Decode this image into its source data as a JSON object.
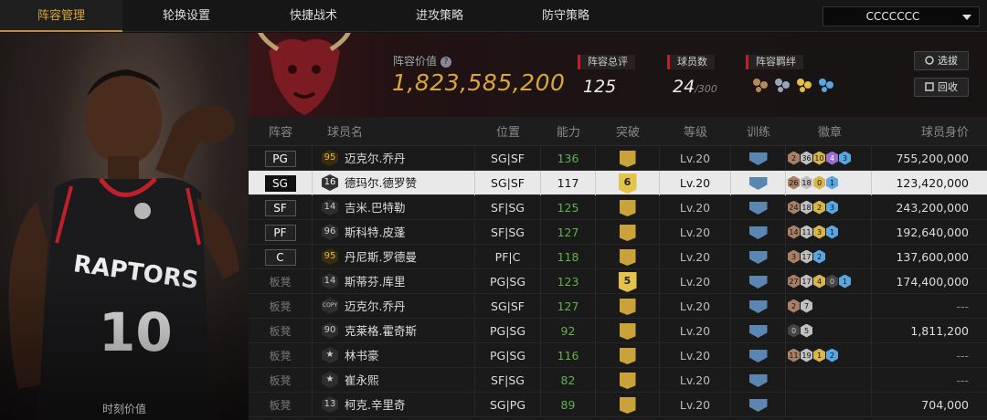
{
  "nav": {
    "tabs": [
      "阵容管理",
      "轮换设置",
      "快捷战术",
      "进攻策略",
      "防守策略"
    ],
    "active_tab": 0,
    "team_select": "CCCCCCC"
  },
  "left_art": {
    "moment_value_label": "时刻价值"
  },
  "header": {
    "lineup_value_label": "阵容价值",
    "lineup_value": "1,823,585,200",
    "rating_label": "阵容总评",
    "rating": "125",
    "players_label": "球员数",
    "players_count": "24",
    "players_max": "/300",
    "bonds_label": "阵容羁绊",
    "select_button": "选拔",
    "recycle_button": "回收"
  },
  "table": {
    "columns": [
      "阵容",
      "球员名",
      "位置",
      "能力",
      "突破",
      "等级",
      "训练",
      "徽章",
      "球员身价"
    ],
    "rows": [
      {
        "pos": "PG",
        "num": "95",
        "name": "迈克尔.乔丹",
        "slot": "SG|SF",
        "ability": "136",
        "breakthrough": "",
        "level": "Lv.20",
        "badges": [
          [
            "2",
            "b"
          ],
          [
            "36",
            "s"
          ],
          [
            "10",
            "g"
          ],
          [
            "4",
            "p"
          ],
          [
            "3",
            "a"
          ]
        ],
        "value": "755,200,000",
        "selected": false
      },
      {
        "pos": "SG",
        "num": "16",
        "name": "德玛尔.德罗赞",
        "slot": "SG|SF",
        "ability": "117",
        "breakthrough": "6",
        "level": "Lv.20",
        "badges": [
          [
            "26",
            "b"
          ],
          [
            "18",
            "s"
          ],
          [
            "0",
            "g"
          ],
          [
            "1",
            "a"
          ]
        ],
        "value": "123,420,000",
        "selected": true
      },
      {
        "pos": "SF",
        "num": "14",
        "name": "吉米.巴特勒",
        "slot": "SF|SG",
        "ability": "125",
        "breakthrough": "",
        "level": "Lv.20",
        "badges": [
          [
            "24",
            "b"
          ],
          [
            "18",
            "s"
          ],
          [
            "2",
            "g"
          ],
          [
            "3",
            "a"
          ]
        ],
        "value": "243,200,000",
        "selected": false
      },
      {
        "pos": "PF",
        "num": "96",
        "name": "斯科特.皮蓬",
        "slot": "SF|SG",
        "ability": "127",
        "breakthrough": "",
        "level": "Lv.20",
        "badges": [
          [
            "14",
            "b"
          ],
          [
            "11",
            "s"
          ],
          [
            "3",
            "g"
          ],
          [
            "1",
            "a"
          ]
        ],
        "value": "192,640,000",
        "selected": false
      },
      {
        "pos": "C",
        "num": "95",
        "name": "丹尼斯.罗德曼",
        "slot": "PF|C",
        "ability": "118",
        "breakthrough": "",
        "level": "Lv.20",
        "badges": [
          [
            "3",
            "b"
          ],
          [
            "17",
            "s"
          ],
          [
            "2",
            "a"
          ]
        ],
        "value": "137,600,000",
        "selected": false
      },
      {
        "pos": "板凳",
        "num": "14",
        "name": "斯蒂芬.库里",
        "slot": "PG|SG",
        "ability": "123",
        "breakthrough": "5",
        "level": "Lv.20",
        "badges": [
          [
            "27",
            "b"
          ],
          [
            "17",
            "s"
          ],
          [
            "4",
            "g"
          ],
          [
            "0",
            "k"
          ],
          [
            "1",
            "a"
          ]
        ],
        "value": "174,400,000",
        "selected": false
      },
      {
        "pos": "板凳",
        "num": "COPY",
        "name": "迈克尔.乔丹",
        "slot": "SG|SF",
        "ability": "127",
        "breakthrough": "",
        "level": "Lv.20",
        "badges": [
          [
            "2",
            "b"
          ],
          [
            "7",
            "s"
          ]
        ],
        "value": "---",
        "selected": false
      },
      {
        "pos": "板凳",
        "num": "90",
        "name": "克莱格.霍奇斯",
        "slot": "PG|SG",
        "ability": "92",
        "breakthrough": "",
        "level": "Lv.20",
        "badges": [
          [
            "0",
            "k"
          ],
          [
            "5",
            "s"
          ]
        ],
        "value": "1,811,200",
        "selected": false
      },
      {
        "pos": "板凳",
        "num": "★",
        "name": "林书豪",
        "slot": "PG|SG",
        "ability": "116",
        "breakthrough": "",
        "level": "Lv.20",
        "badges": [
          [
            "11",
            "b"
          ],
          [
            "19",
            "s"
          ],
          [
            "1",
            "g"
          ],
          [
            "2",
            "a"
          ]
        ],
        "value": "---",
        "selected": false
      },
      {
        "pos": "板凳",
        "num": "★",
        "name": "崔永熙",
        "slot": "SF|SG",
        "ability": "82",
        "breakthrough": "",
        "level": "Lv.20",
        "badges": [],
        "value": "---",
        "selected": false
      },
      {
        "pos": "板凳",
        "num": "13",
        "name": "柯克.辛里奇",
        "slot": "SG|PG",
        "ability": "89",
        "breakthrough": "",
        "level": "Lv.20",
        "badges": [],
        "value": "704,000",
        "selected": false
      }
    ]
  },
  "colors": {
    "accent_gold": "#d9a63a",
    "ability_green": "#5fb34a",
    "red_marker": "#c0202a"
  }
}
